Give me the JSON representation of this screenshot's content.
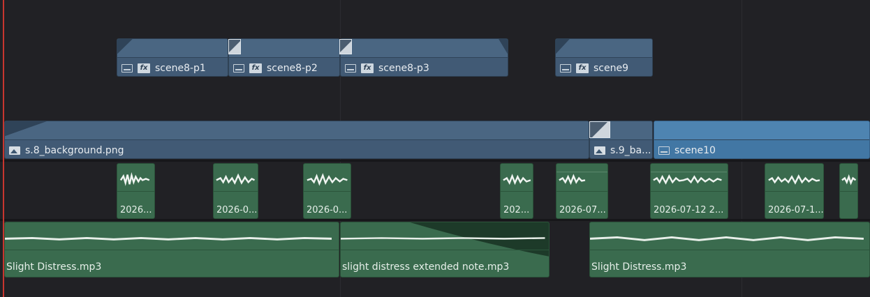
{
  "timeline": {
    "video_track_2": {
      "clips": [
        {
          "label": "scene8-p1",
          "icons": [
            "compound-clip-icon",
            "fx-icon"
          ]
        },
        {
          "label": "scene8-p2",
          "icons": [
            "compound-clip-icon",
            "fx-icon"
          ]
        },
        {
          "label": "scene8-p3",
          "icons": [
            "compound-clip-icon",
            "fx-icon"
          ]
        },
        {
          "label": "scene9",
          "icons": [
            "compound-clip-icon",
            "fx-icon"
          ]
        }
      ]
    },
    "video_track_1": {
      "clips": [
        {
          "label": "s.8_background.png",
          "icon": "image-icon"
        },
        {
          "label": "s.9_ba...",
          "icon": "image-icon"
        },
        {
          "label": "scene10",
          "icon": "compound-clip-icon",
          "selected": true
        }
      ]
    },
    "audio_track_2": {
      "clips": [
        {
          "label": "2026..."
        },
        {
          "label": "2026-0..."
        },
        {
          "label": "2026-0..."
        },
        {
          "label": "202..."
        },
        {
          "label": "2026-07..."
        },
        {
          "label": "2026-07-12 2..."
        },
        {
          "label": "2026-07-1..."
        },
        {
          "label": ""
        }
      ]
    },
    "audio_track_1": {
      "clips": [
        {
          "label": "Slight Distress.mp3"
        },
        {
          "label": "slight distress extended note.mp3"
        },
        {
          "label": "Slight Distress.mp3"
        }
      ]
    },
    "colors": {
      "video_clip": "#415a75",
      "selected_video_clip": "#4277a4",
      "audio_clip": "#3a6b4e",
      "playhead": "#c8362e",
      "background": "#212125"
    }
  }
}
